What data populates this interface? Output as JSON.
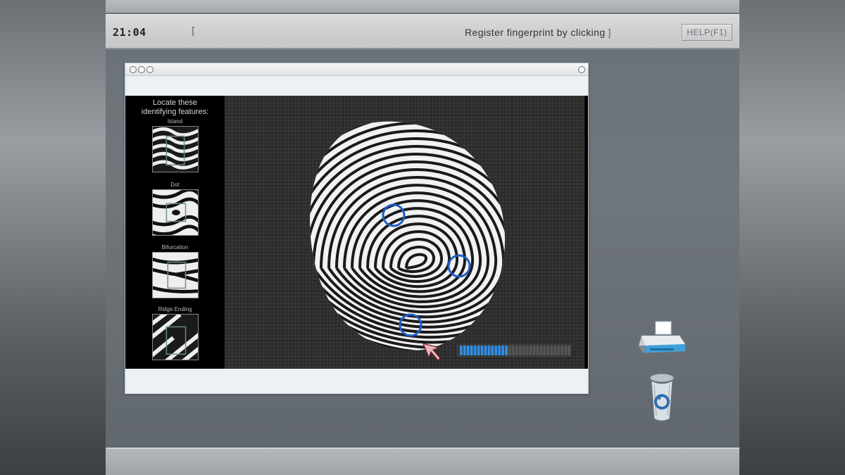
{
  "topbar": {
    "clock": "21:04",
    "bracket_open": "[",
    "status_text": "Register fingerprint by clicking",
    "bracket_close": "]",
    "help_label": "HELP(F1)"
  },
  "sidebar": {
    "heading": "Locate these identifying features:",
    "features": [
      {
        "label": "Island"
      },
      {
        "label": "Dot"
      },
      {
        "label": "Bifurcation"
      },
      {
        "label": "Ridge Ending"
      }
    ]
  },
  "scanner": {
    "progress": 0.45,
    "progress_segments_total": 32,
    "marker_color": "#1b5cc9",
    "progress_color": "#2f8ee8"
  },
  "desktop": {
    "icons": [
      "printer-icon",
      "recycle-bin-icon"
    ]
  }
}
